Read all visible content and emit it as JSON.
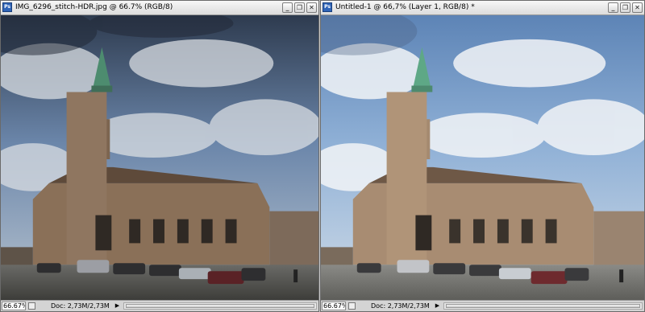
{
  "windows": [
    {
      "title": "IMG_6296_stitch-HDR.jpg @ 66.7% (RGB/8)",
      "zoom": "66.67%",
      "doc_size": "Doc: 2,73M/2,73M",
      "app_icon": "Ps",
      "sky_top": "#2e3b4f",
      "sky_mid": "#6b86aa",
      "sky_low": "#b7c3cf"
    },
    {
      "title": "Untitled-1 @ 66,7% (Layer 1, RGB/8) *",
      "zoom": "66.67%",
      "doc_size": "Doc: 2,73M/2,73M",
      "app_icon": "Ps",
      "sky_top": "#5d84b6",
      "sky_mid": "#8fb0d6",
      "sky_low": "#cfdbe7"
    }
  ],
  "window_buttons": [
    "minimize-icon",
    "restore-icon",
    "close-icon"
  ],
  "window_button_glyphs": [
    "_",
    "❐",
    "✕"
  ],
  "status_arrow": "▶"
}
